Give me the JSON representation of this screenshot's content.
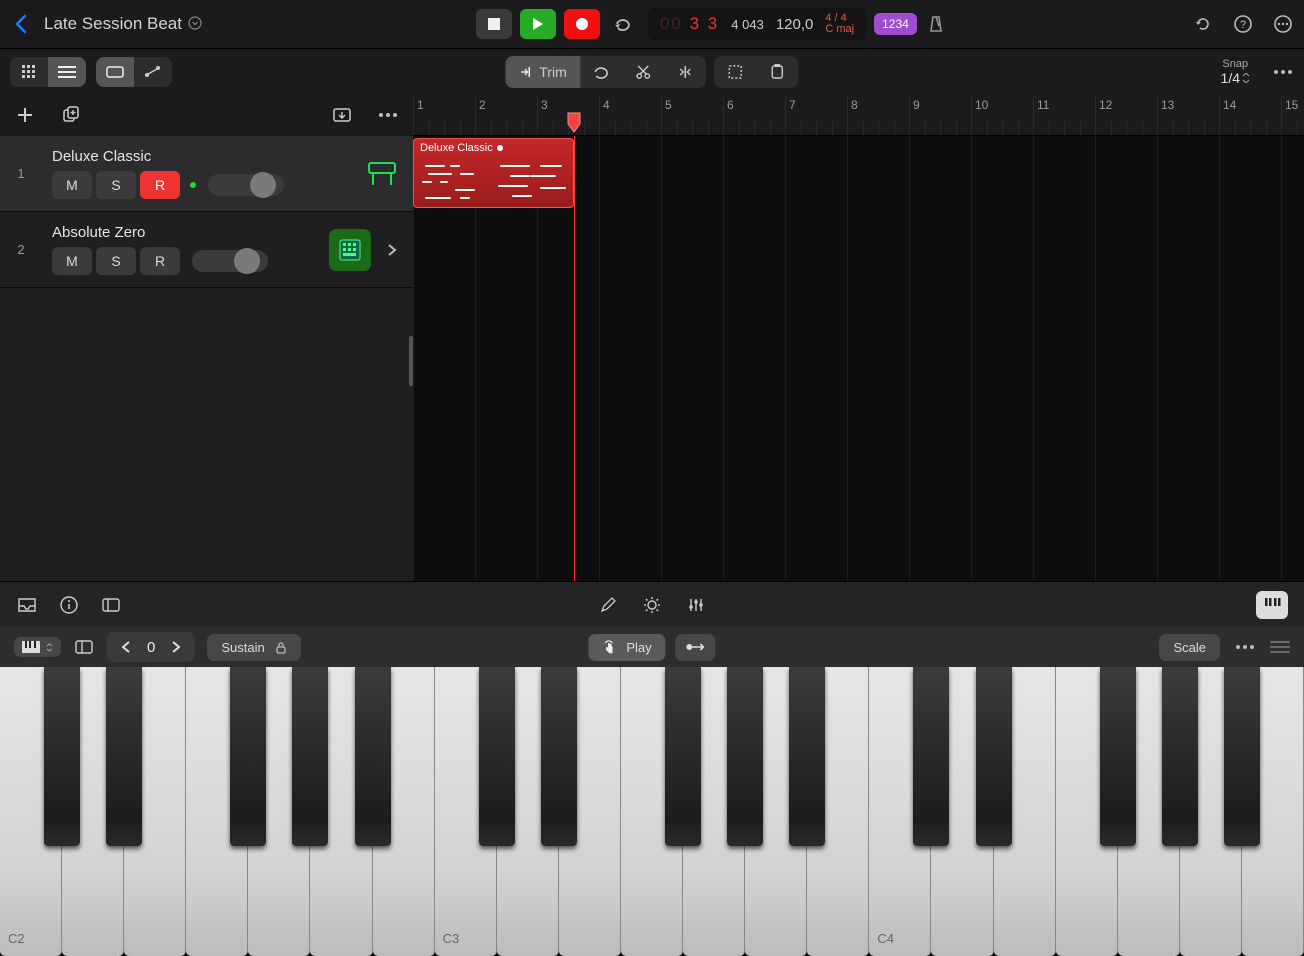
{
  "header": {
    "project_title": "Late Session Beat",
    "position_main": "3 3",
    "position_sub": "4 043",
    "tempo": "120,0",
    "time_sig": "4 / 4",
    "key": "C maj",
    "countin": "1234"
  },
  "toolbar": {
    "trim": "Trim",
    "snap_label": "Snap",
    "snap_value": "1/4"
  },
  "ruler": {
    "bars": [
      "1",
      "2",
      "3",
      "4",
      "5",
      "6",
      "7",
      "8",
      "9",
      "10",
      "11",
      "12",
      "13",
      "14",
      "15"
    ]
  },
  "tracks": [
    {
      "num": "1",
      "name": "Deluxe Classic",
      "mute": "M",
      "solo": "S",
      "rec": "R",
      "rec_armed": true,
      "selected": true
    },
    {
      "num": "2",
      "name": "Absolute Zero",
      "mute": "M",
      "solo": "S",
      "rec": "R",
      "rec_armed": false,
      "selected": false
    }
  ],
  "region": {
    "name": "Deluxe Classic"
  },
  "kb": {
    "octave": "0",
    "sustain": "Sustain",
    "play": "Play",
    "scale": "Scale",
    "note_labels": [
      "C2",
      "C3",
      "C4"
    ]
  }
}
